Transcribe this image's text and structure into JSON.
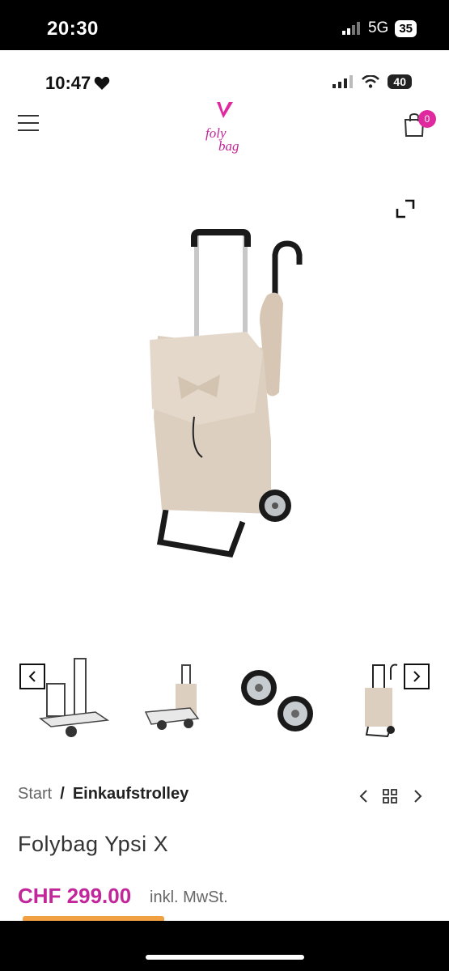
{
  "outer_status": {
    "time": "20:30",
    "network": "5G",
    "battery": "35"
  },
  "inner_status": {
    "time": "10:47",
    "battery": "40"
  },
  "header": {
    "logo_line1": "foly",
    "logo_line2": "bag",
    "cart_count": "0"
  },
  "breadcrumb": {
    "start": "Start",
    "separator": "/",
    "current": "Einkaufstrolley"
  },
  "product": {
    "title": "Folybag Ypsi X",
    "price": "CHF 299.00",
    "price_note": "inkl. MwSt."
  },
  "colors": {
    "brand": "#c2269a",
    "accent": "#f2a142",
    "badge": "#e0299e",
    "bag": "#dccfc0"
  }
}
